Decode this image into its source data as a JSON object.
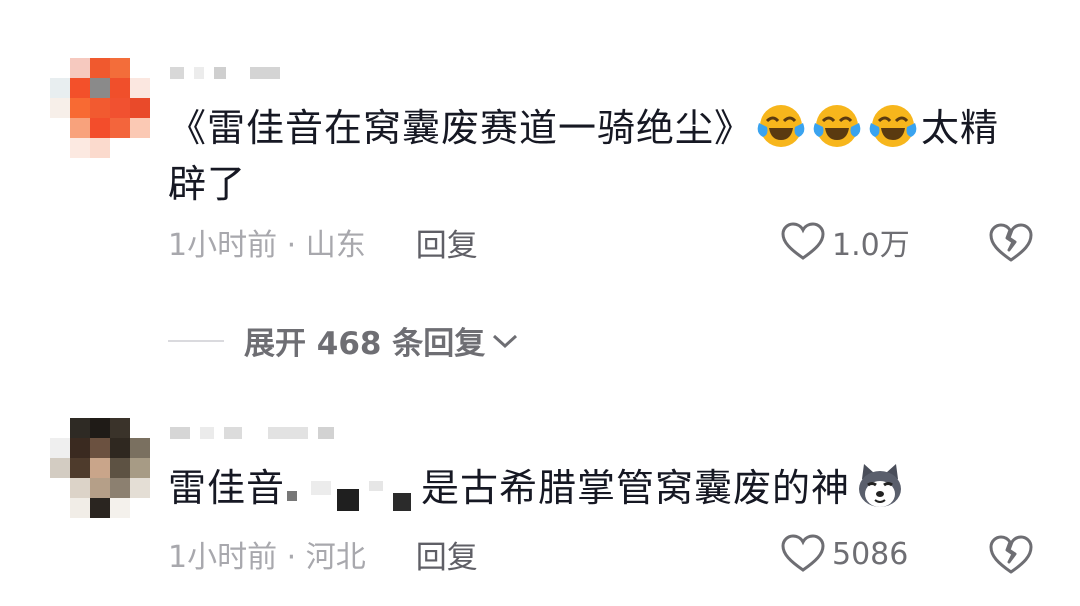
{
  "comments": [
    {
      "content_main": "《雷佳音在窝囊废赛道一骑绝尘》",
      "content_tail": "太精辟了",
      "emoji": "laugh-cry-emoji",
      "time_location": "1小时前 · 山东",
      "reply_label": "回复",
      "likes": "1.0万"
    },
    {
      "content_prefix": "雷佳音",
      "content_suffix": "是古希腊掌管窝囊废的神",
      "emoji": "husky-dog-emoji",
      "time_location": "1小时前 · 河北",
      "reply_label": "回复",
      "likes": "5086"
    }
  ],
  "expand_replies": {
    "label": "展开 468 条回复"
  },
  "colors": {
    "text_primary": "#161823",
    "text_secondary": "#a8a8ad",
    "action_text": "#5f5f66",
    "divider": "#dadade",
    "emoji_yellow": "#f7b61c",
    "emoji_tear": "#3aa3ef"
  }
}
